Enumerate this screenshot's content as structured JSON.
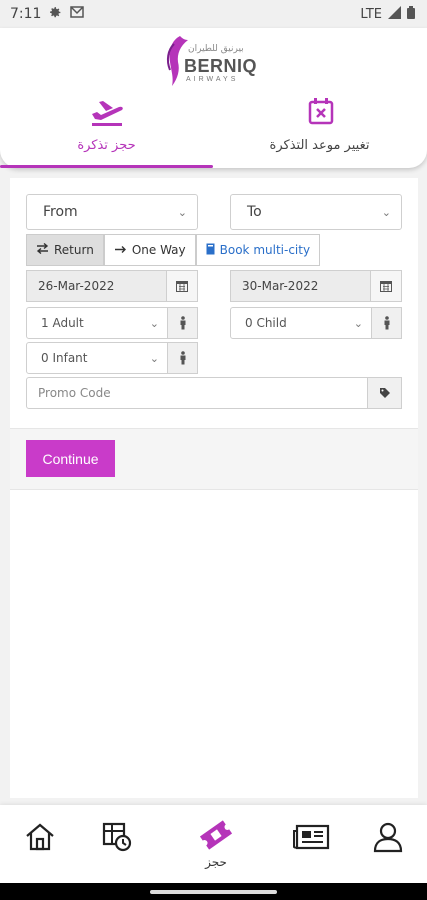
{
  "status_bar": {
    "time": "7:11",
    "network": "LTE"
  },
  "header": {
    "logo_name": "BERNIQ",
    "logo_sub": "AIRWAYS",
    "logo_arabic": "بيرنيق للطيران",
    "tabs": [
      {
        "label": "حجز تذكرة",
        "icon": "airplane-icon"
      },
      {
        "label": "تغيير موعد التذكرة",
        "icon": "calendar-x-icon"
      }
    ]
  },
  "form": {
    "from_label": "From",
    "to_label": "To",
    "trip_types": {
      "return_label": "Return",
      "oneway_label": "One Way",
      "multicity_label": "Book multi-city"
    },
    "depart_date": "26-Mar-2022",
    "return_date": "30-Mar-2022",
    "adults": "1 Adult",
    "children": "0 Child",
    "infants": "0 Infant",
    "promo_placeholder": "Promo Code",
    "continue_label": "Continue"
  },
  "bottom_nav": {
    "active_label": "حجز"
  },
  "colors": {
    "accent": "#c93bc9",
    "tab_active": "#b534b9",
    "link": "#2a6fc9"
  }
}
